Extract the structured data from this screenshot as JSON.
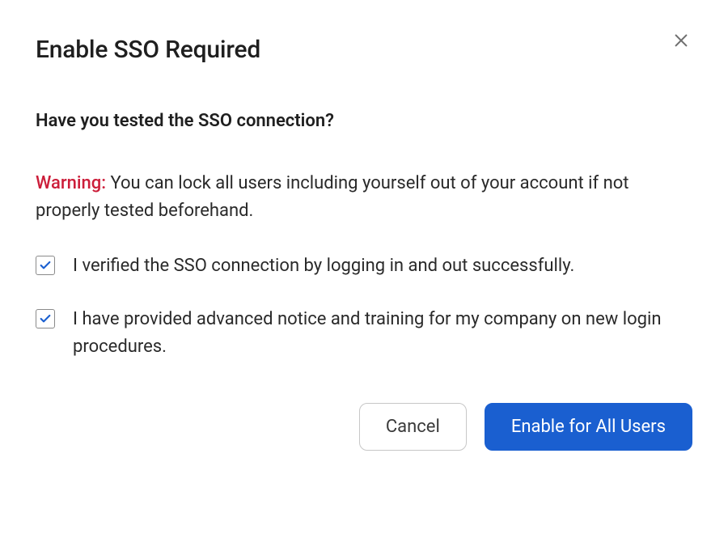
{
  "dialog": {
    "title": "Enable SSO Required",
    "subheading": "Have you tested the SSO connection?",
    "warning_label": "Warning:",
    "warning_text": " You can lock all users including yourself out of your account if not properly tested beforehand.",
    "checks": [
      {
        "label": "I verified the SSO connection by logging in and out successfully.",
        "checked": true
      },
      {
        "label": "I have provided advanced notice and training for my company on new login procedures.",
        "checked": true
      }
    ],
    "buttons": {
      "cancel": "Cancel",
      "confirm": "Enable for All Users"
    }
  },
  "colors": {
    "primary": "#1a5fd0",
    "warning": "#cc1e3a"
  }
}
